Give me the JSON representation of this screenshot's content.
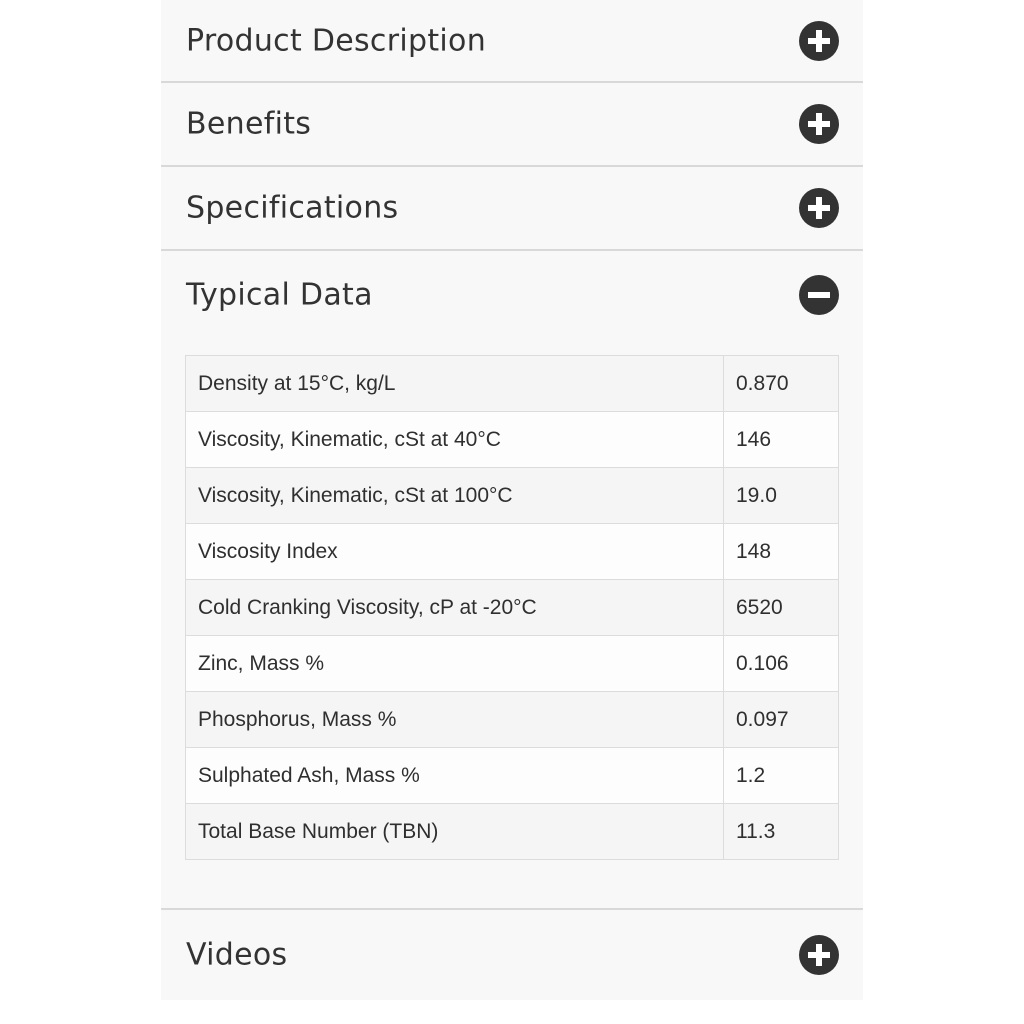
{
  "accordion": {
    "sections": [
      {
        "title": "Product Description",
        "state": "collapsed",
        "icon": "plus-circle-icon"
      },
      {
        "title": "Benefits",
        "state": "collapsed",
        "icon": "plus-circle-icon"
      },
      {
        "title": "Specifications",
        "state": "collapsed",
        "icon": "plus-circle-icon"
      },
      {
        "title": "Typical Data",
        "state": "expanded",
        "icon": "minus-circle-icon"
      },
      {
        "title": "Videos",
        "state": "collapsed",
        "icon": "plus-circle-icon"
      }
    ]
  },
  "typical_data": {
    "rows": [
      {
        "property": "Density at 15°C, kg/L",
        "value": "0.870"
      },
      {
        "property": "Viscosity, Kinematic, cSt at 40°C",
        "value": "146"
      },
      {
        "property": "Viscosity, Kinematic, cSt at 100°C",
        "value": "19.0"
      },
      {
        "property": "Viscosity Index",
        "value": "148"
      },
      {
        "property": "Cold Cranking Viscosity, cP at -20°C",
        "value": "6520"
      },
      {
        "property": "Zinc, Mass %",
        "value": "0.106"
      },
      {
        "property": "Phosphorus, Mass %",
        "value": "0.097"
      },
      {
        "property": "Sulphated Ash, Mass %",
        "value": "1.2"
      },
      {
        "property": "Total Base Number (TBN)",
        "value": "11.3"
      }
    ]
  },
  "colors": {
    "icon": "#333333",
    "text": "#333333",
    "divider": "#d9d9d9",
    "panel_bg": "#f8f8f8"
  }
}
